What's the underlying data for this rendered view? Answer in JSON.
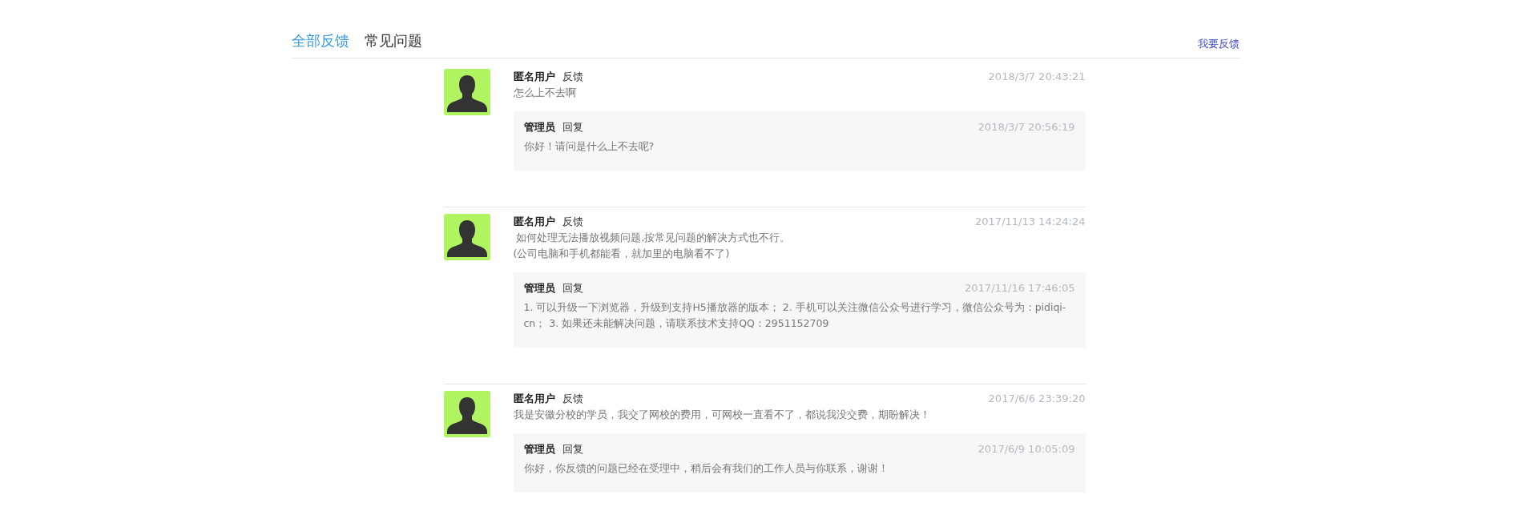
{
  "tabs": [
    {
      "label": "全部反馈",
      "selected": true
    },
    {
      "label": "常见问题",
      "selected": false
    }
  ],
  "feedback_link": "我要反馈",
  "feedback": [
    {
      "user": "匿名用户",
      "action": "反馈",
      "time": "2018/3/7 20:43:21",
      "content": [
        "怎么上不去啊"
      ],
      "reply": {
        "user": "管理员",
        "action": "回复",
        "time": "2018/3/7 20:56:19",
        "content": "你好！请问是什么上不去呢?"
      }
    },
    {
      "user": "匿名用户",
      "action": "反馈",
      "time": "2017/11/13 14:24:24",
      "content": [
        " 如何处理无法播放视频问题,按常见问题的解决方式也不行。",
        "(公司电脑和手机都能看，就加里的电脑看不了)"
      ],
      "reply": {
        "user": "管理员",
        "action": "回复",
        "time": "2017/11/16 17:46:05",
        "content": "1. 可以升级一下浏览器，升级到支持H5播放器的版本； 2. 手机可以关注微信公众号进行学习，微信公众号为：pidiqi-cn； 3. 如果还未能解决问题，请联系技术支持QQ：2951152709"
      }
    },
    {
      "user": "匿名用户",
      "action": "反馈",
      "time": "2017/6/6 23:39:20",
      "content": [
        "我是安徽分校的学员，我交了网校的费用，可网校一直看不了，都说我没交费，期盼解决！"
      ],
      "reply": {
        "user": "管理员",
        "action": "回复",
        "time": "2017/6/9 10:05:09",
        "content": "你好，你反馈的问题已经在受理中，稍后会有我们的工作人员与你联系，谢谢！"
      }
    }
  ]
}
